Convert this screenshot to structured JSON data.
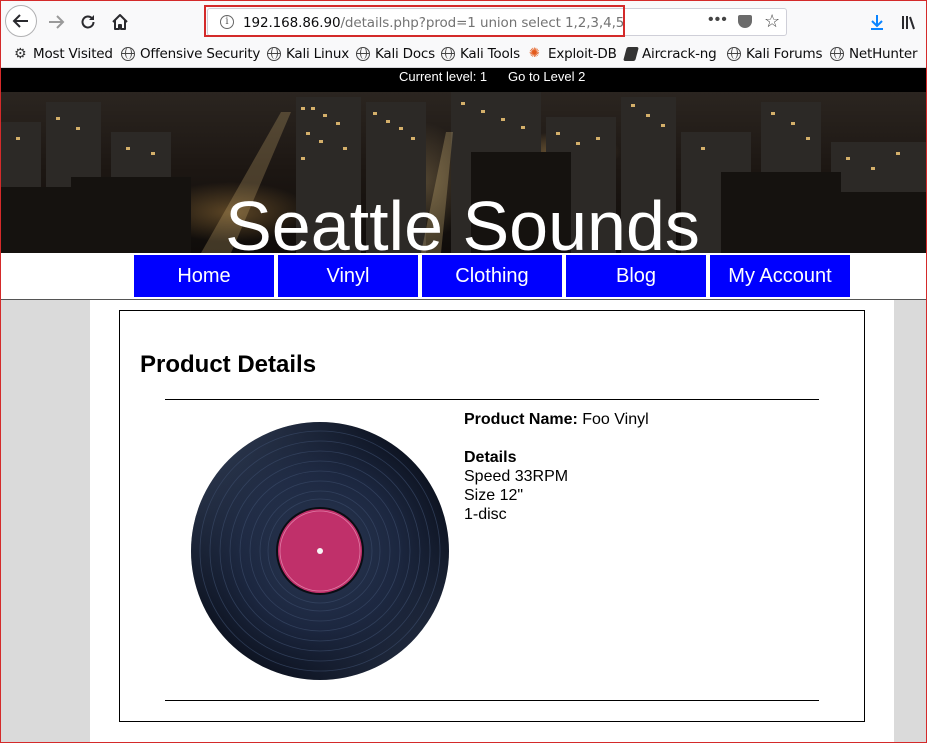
{
  "browser": {
    "url_host": "192.168.86.90",
    "url_path": "/details.php?prod=1 union select 1,2,3,4,5",
    "url_more": "•••",
    "bookmarks": [
      {
        "label": "Most Visited",
        "icon": "gear-icon"
      },
      {
        "label": "Offensive Security",
        "icon": "globe-icon"
      },
      {
        "label": "Kali Linux",
        "icon": "globe-icon"
      },
      {
        "label": "Kali Docs",
        "icon": "globe-icon"
      },
      {
        "label": "Kali Tools",
        "icon": "globe-icon"
      },
      {
        "label": "Exploit-DB",
        "icon": "exploit-db-icon"
      },
      {
        "label": "Aircrack-ng",
        "icon": "aircrack-icon"
      },
      {
        "label": "Kali Forums",
        "icon": "globe-icon"
      },
      {
        "label": "NetHunter",
        "icon": "globe-icon"
      }
    ]
  },
  "level": {
    "current": "Current level: 1",
    "next": "Go to Level 2"
  },
  "site": {
    "title": "Seattle Sounds",
    "nav": [
      "Home",
      "Vinyl",
      "Clothing",
      "Blog",
      "My Account"
    ],
    "nav_color": "#0000ff"
  },
  "product": {
    "heading": "Product Details",
    "name_label": "Product Name:",
    "name": "Foo Vinyl",
    "details_label": "Details",
    "details": [
      "Speed 33RPM",
      "Size 12\"",
      "1-disc"
    ],
    "label_color": "#c0306a"
  }
}
